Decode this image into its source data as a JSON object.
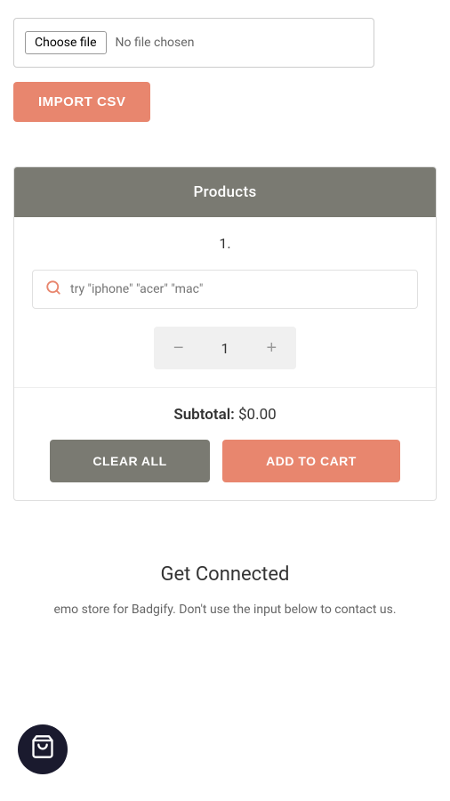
{
  "file": {
    "choose_label": "Choose file",
    "no_file_label": "No file chosen"
  },
  "import_btn": {
    "label": "IMPORT CSV"
  },
  "products": {
    "header": "Products",
    "item_number": "1.",
    "search_placeholder": "try \"iphone\" \"acer\" \"mac\"",
    "quantity": 1,
    "subtotal_label": "Subtotal:",
    "subtotal_value": "$0.00"
  },
  "actions": {
    "clear_label": "CLEAR ALL",
    "add_cart_label": "ADD TO CART"
  },
  "get_connected": {
    "title": "Get Connected",
    "description": "emo store for Badgify. Don't use the input below to contact us."
  },
  "colors": {
    "accent": "#e8866e",
    "header_bg": "#7a7a72"
  }
}
